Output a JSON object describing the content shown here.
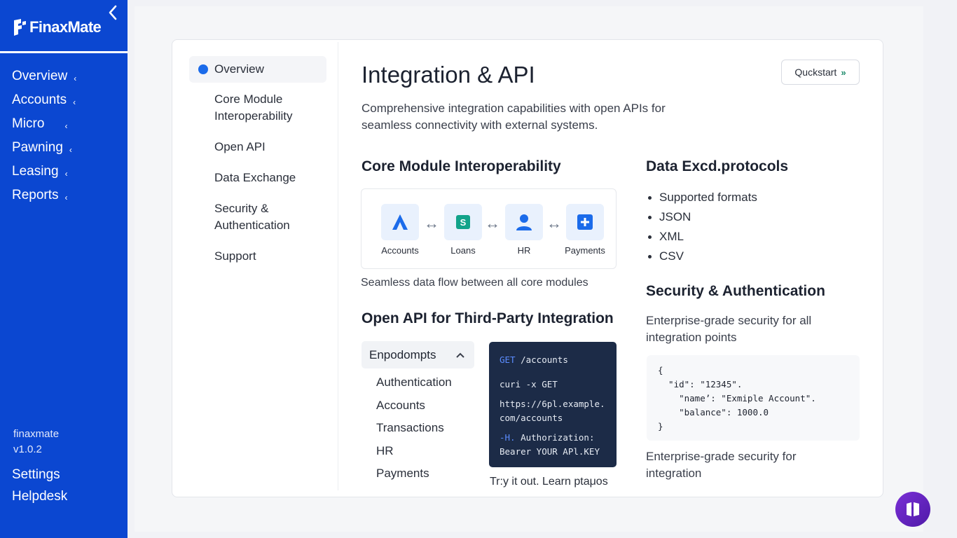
{
  "sidebar": {
    "brand": "FinaxMate",
    "nav": [
      {
        "label": "Overview"
      },
      {
        "label": "Accounts"
      },
      {
        "label": "Micro"
      },
      {
        "label": "Pawning"
      },
      {
        "label": "Leasing"
      },
      {
        "label": "Reports"
      }
    ],
    "caret_glyph": "‹",
    "footer_name": "finaxmate",
    "footer_version": "v1.0.2",
    "settings": "Settings",
    "helpdesk": "Helpdesk"
  },
  "inner_nav": [
    {
      "label": "Overview"
    },
    {
      "label": "Core Module Interoperability"
    },
    {
      "label": "Open API"
    },
    {
      "label": "Data Exchange"
    },
    {
      "label": "Security & Authentication"
    },
    {
      "label": "Support"
    }
  ],
  "page": {
    "title": "Integration & API",
    "quickstart_label": "Quckstart",
    "quickstart_icon": "»",
    "intro": "Comprehensive integration capabilities with open APIs for seamless connectivity with external systems."
  },
  "core_modules": {
    "title": "Core Module Interoperability",
    "arrow_glyph": "↔",
    "modules": [
      {
        "label": "Accounts",
        "icon": "accounts-logo-icon"
      },
      {
        "label": "Loans",
        "icon": "loans-dollar-icon"
      },
      {
        "label": "HR",
        "icon": "person-icon"
      },
      {
        "label": "Payments",
        "icon": "plus-square-icon"
      }
    ],
    "caption": "Seamless data flow between all core modules"
  },
  "open_api": {
    "title": "Open API for Third-Party Integration",
    "endpoints_label": "Enpodompts",
    "endpoints": [
      "Authentication",
      "Accounts",
      "Transactions",
      "HR",
      "Payments"
    ],
    "code": {
      "method": "GET",
      "path": "/accounts",
      "line2": "curi -x GET",
      "line3": "https://6pl.example.",
      "line4": "com/accounts",
      "flag": "-H.",
      "line5a": "Authorization:",
      "line6": "Bearer YOUR APl.KEY"
    },
    "try_text": "Tr:y it out. Learn ptaμos"
  },
  "data_exchange": {
    "title": "Data Excd.protocols",
    "bullets": [
      "Supported formats",
      "JSON",
      "XML",
      "CSV"
    ]
  },
  "security": {
    "title": "Security & Authentication",
    "description": "Enterprise-grade security for all integration points",
    "json_sample": "{\n  \"id\": \"12345\".\n    \"name’: \"Exmiple Account\".\n    \"balance\": 1000.0\n}",
    "footer": "Enterprise-grade security for integration"
  },
  "colors": {
    "sidebar_bg": "#0b47d1",
    "accent": "#1b6bea",
    "code_bg": "#1c2b47",
    "fab": "#6a25c4"
  }
}
